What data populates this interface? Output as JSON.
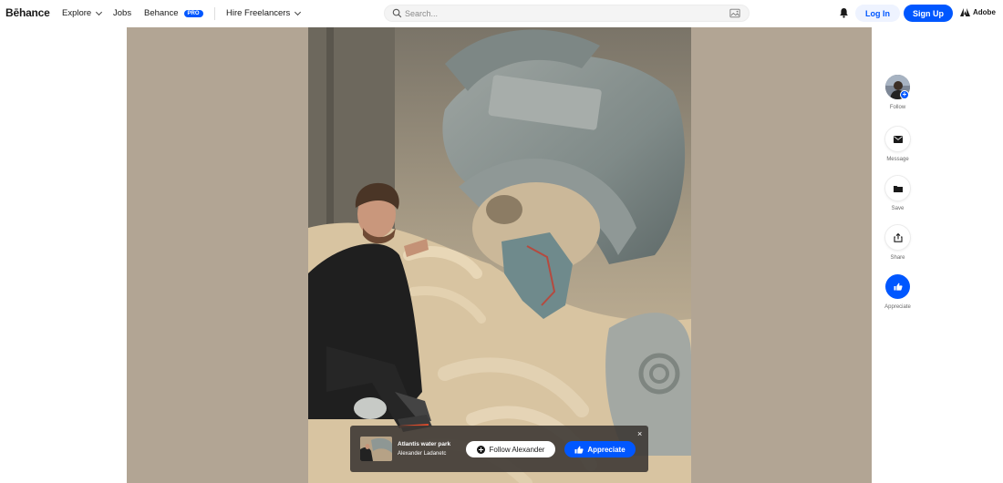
{
  "header": {
    "logo": "Bēhance",
    "nav": {
      "explore": "Explore",
      "jobs": "Jobs",
      "behance": "Behance",
      "pro_badge": "PRO",
      "hire": "Hire Freelancers"
    },
    "search": {
      "placeholder": "Search..."
    },
    "login": "Log In",
    "signup": "Sign Up",
    "adobe": "Adobe"
  },
  "card": {
    "title": "Atlantis water park",
    "author": "Alexander Ladanetc",
    "follow_label": "Follow Alexander",
    "appreciate_label": "Appreciate",
    "close": "×"
  },
  "rail": {
    "follow": "Follow",
    "message": "Message",
    "save": "Save",
    "share": "Share",
    "appreciate": "Appreciate"
  },
  "colors": {
    "accent": "#0057ff",
    "backdrop": "#b2a594"
  },
  "icons": [
    "search-icon",
    "image-search-icon",
    "bell-icon",
    "adobe-logo-icon",
    "plus-icon",
    "thumbs-up-icon",
    "mail-icon",
    "folder-icon",
    "share-icon",
    "close-icon",
    "chevron-down-icon"
  ]
}
